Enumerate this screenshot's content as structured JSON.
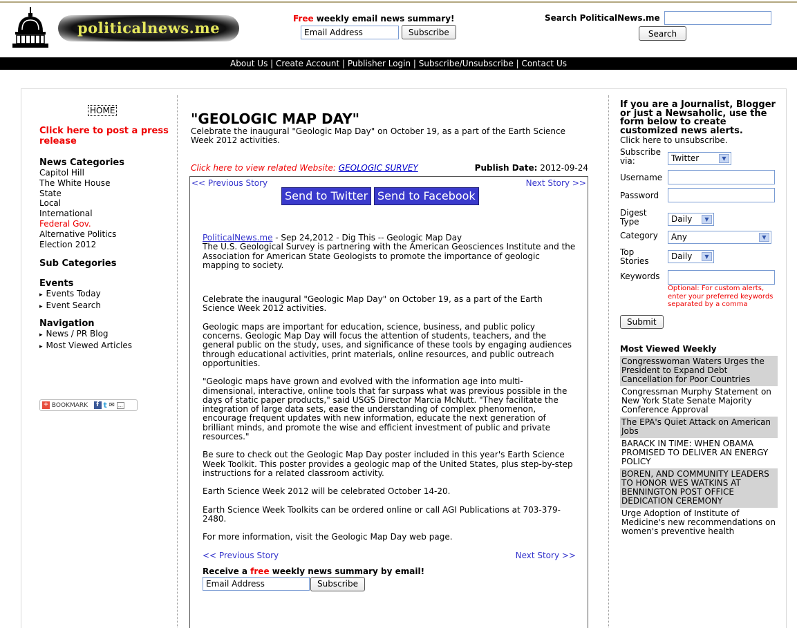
{
  "site": {
    "name": "politicalnews.me"
  },
  "newsletter": {
    "free_word": "Free",
    "headline_rest": " weekly email news summary!",
    "email_placeholder": "Email Address",
    "subscribe_label": "Subscribe"
  },
  "search": {
    "label": "Search PoliticalNews.me",
    "button_label": "Search"
  },
  "nav": [
    "About Us",
    "Create Account",
    "Publisher Login",
    "Subscribe/Unsubscribe",
    "Contact Us"
  ],
  "left": {
    "home_label": "HOME",
    "post_release": "Click here to post a press release",
    "news_categories_heading": "News Categories",
    "categories": [
      "Capitol Hill",
      "The White House",
      "State",
      "Local",
      "International",
      "Federal Gov.",
      "Alternative Politics",
      "Election 2012"
    ],
    "active_category": "Federal Gov.",
    "sub_categories_heading": "Sub Categories",
    "events_heading": "Events",
    "events": [
      "Events Today",
      "Event Search"
    ],
    "navigation_heading": "Navigation",
    "navigation": [
      "News / PR Blog",
      "Most Viewed Articles"
    ],
    "bookmark_label": "BOOKMARK"
  },
  "article": {
    "title": "\"GEOLOGIC MAP DAY\"",
    "subtitle": "Celebrate the inaugural \"Geologic Map Day\" on October 19, as a part of the Earth Science Week 2012 activities.",
    "related_prefix": "Click here to view related Website: ",
    "related_link": "GEOLOGIC SURVEY",
    "publish_label": "Publish Date:",
    "publish_date": "2012-09-24",
    "prev_label": "<< Previous Story",
    "next_label": "Next Story >>",
    "share_twitter": "Send to Twitter",
    "share_facebook": "Send to Facebook",
    "source_link": "PoliticalNews.me",
    "source_rest": " - Sep 24,2012 - Dig This -- Geologic Map Day",
    "lead": "The U.S. Geological Survey is partnering with the American Geosciences Institute and the Association for American State Geologists to promote the importance of geologic mapping to society.",
    "paragraphs": [
      "Celebrate the inaugural \"Geologic Map Day\" on October 19, as a part of the Earth Science Week 2012 activities.",
      "Geologic maps are important for education, science, business, and public policy concerns. Geologic Map Day will focus the attention of students, teachers, and the general public on the study, uses, and significance of these tools by engaging audiences through educational activities, print materials, online resources, and public outreach opportunities.",
      "\"Geologic maps have grown and evolved with the information age into multi-dimensional, interactive, online tools that far surpass what was previous possible in the days of static paper products,\" said USGS Director Marcia McNutt. \"They facilitate the integration of large data sets, ease the understanding of complex phenomenon, encourage frequent updates with new information, educate the next generation of brilliant minds, and promote the wise and efficient investment of public and private resources.\"",
      "Be sure to check out the Geologic Map Day poster included in this year's Earth Science Week Toolkit. This poster provides a geologic map of the United States, plus step-by-step instructions for a related classroom activity.",
      "Earth Science Week 2012 will be celebrated October 14-20.",
      "Earth Science Week Toolkits can be ordered online or call AGI Publications at 703-379-2480.",
      "For more information, visit the Geologic Map Day web page."
    ],
    "receive_prefix": "Receive a ",
    "receive_free": "free",
    "receive_rest": " weekly news summary by email!",
    "email_placeholder": "Email Address",
    "subscribe_label": "Subscribe"
  },
  "alerts": {
    "intro": "If you are a Journalist, Blogger or just a Newsaholic, use the form below to create customized news alerts.",
    "unsubscribe": "Click here to unsubscribe.",
    "subscribe_via_label": "Subscribe via:",
    "subscribe_via_value": "Twitter",
    "username_label": "Username",
    "password_label": "Password",
    "digest_label": "Digest Type",
    "digest_value": "Daily",
    "category_label": "Category",
    "category_value": "Any",
    "top_label": "Top Stories",
    "top_value": "Daily",
    "keywords_label": "Keywords",
    "keywords_note": "Optional: For custom alerts, enter your preferred keywords separated by a comma",
    "submit_label": "Submit"
  },
  "most_viewed": {
    "heading": "Most Viewed Weekly",
    "items": [
      "Congresswoman Waters Urges the President to Expand Debt Cancellation for Poor Countries",
      "Congressman Murphy Statement on New York State Senate Majority Conference Approval",
      "The EPA's Quiet Attack on American Jobs",
      "BARACK IN TIME: WHEN OBAMA PROMISED TO DELIVER AN ENERGY POLICY",
      "BOREN, AND COMMUNITY LEADERS TO HONOR WES WATKINS AT BENNINGTON POST OFFICE DEDICATION CEREMONY",
      "Urge Adoption of Institute of Medicine's new recommendations on women's preventive health"
    ]
  }
}
